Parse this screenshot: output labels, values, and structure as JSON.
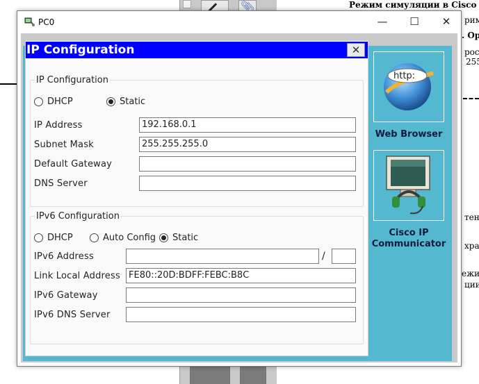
{
  "background_doc": {
    "title": "Режим симуляции в Cisco Pa",
    "lines": [
      "рим",
      ". Ор",
      "рост",
      "255",
      "",
      "тены",
      "хран",
      "ежим",
      "ции"
    ]
  },
  "window": {
    "title": "PC0",
    "minimize": "—",
    "maximize": "☐",
    "close": "✕"
  },
  "ip_config": {
    "header": "IP Configuration",
    "close": "✕",
    "ipv4": {
      "legend": "IP Configuration",
      "mode_options": [
        "DHCP",
        "Static"
      ],
      "selected_mode": "Static",
      "ip_address_label": "IP Address",
      "ip_address": "192.168.0.1",
      "subnet_mask_label": "Subnet Mask",
      "subnet_mask": "255.255.255.0",
      "gateway_label": "Default Gateway",
      "gateway": "",
      "dns_label": "DNS Server",
      "dns": ""
    },
    "ipv6": {
      "legend": "IPv6 Configuration",
      "mode_options": [
        "DHCP",
        "Auto Config",
        "Static"
      ],
      "selected_mode": "Static",
      "address_label": "IPv6 Address",
      "address": "",
      "prefix_separator": "/",
      "prefix": "",
      "link_local_label": "Link Local Address",
      "link_local": "FE80::20D:BDFF:FEBC:B8C",
      "gateway_label": "IPv6 Gateway",
      "gateway": "",
      "dns_label": "IPv6 DNS Server",
      "dns": ""
    }
  },
  "apps": {
    "web_browser": {
      "label": "Web Browser",
      "icon_text": "http:"
    },
    "cisco_ip_communicator": {
      "label_line1": "Cisco IP",
      "label_line2": "Communicator"
    }
  },
  "colors": {
    "header_blue": "#0000fe",
    "desktop_teal": "#55b8d1"
  }
}
